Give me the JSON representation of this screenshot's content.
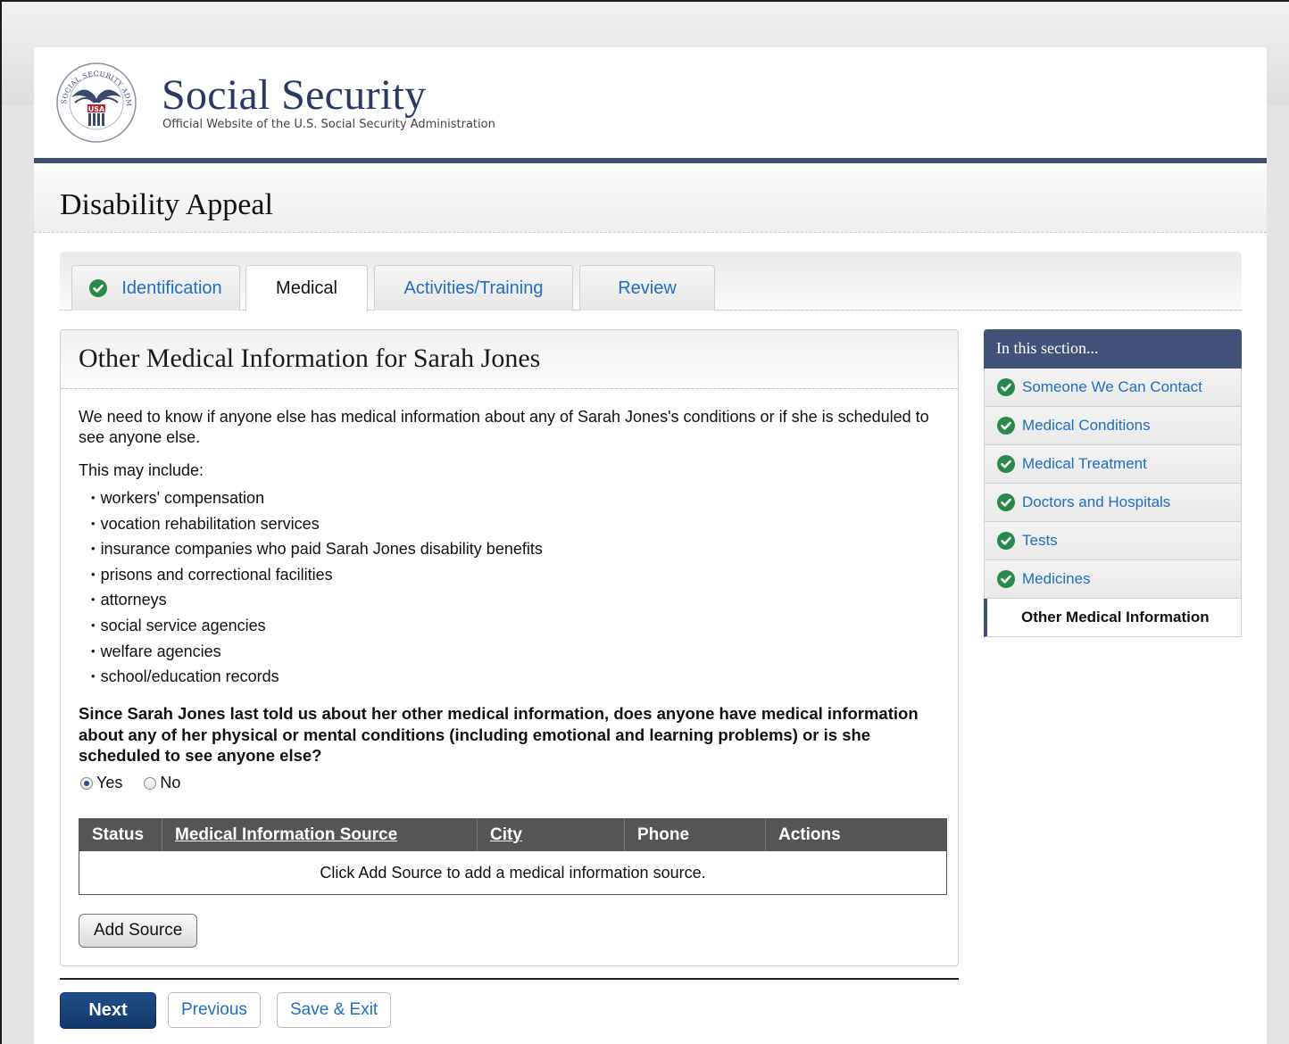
{
  "header": {
    "seal_text": "SOCIAL SECURITY ADMINISTRATION",
    "seal_usa": "USA",
    "brand_title": "Social Security",
    "brand_subtitle": "Official Website of the U.S. Social Security Administration"
  },
  "app_title": "Disability Appeal",
  "tabs": [
    {
      "label": "Identification",
      "completed": true,
      "active": false
    },
    {
      "label": "Medical",
      "completed": false,
      "active": true
    },
    {
      "label": "Activities/Training",
      "completed": false,
      "active": false
    },
    {
      "label": "Review",
      "completed": false,
      "active": false
    }
  ],
  "main": {
    "title": "Other Medical Information for Sarah Jones",
    "intro": "We need to know if anyone else has medical information about any of Sarah Jones's conditions or if she is scheduled to see anyone else.",
    "may_include_label": "This may include:",
    "may_include_items": [
      "workers' compensation",
      "vocation rehabilitation services",
      "insurance companies who paid Sarah Jones disability benefits",
      "prisons and correctional facilities",
      "attorneys",
      "social service agencies",
      "welfare agencies",
      "school/education records"
    ],
    "question": "Since Sarah Jones last told us about her other medical information, does anyone have medical information about any of her physical or mental conditions (including emotional and learning problems) or is she scheduled to see anyone else?",
    "answer_options": [
      {
        "label": "Yes",
        "selected": true
      },
      {
        "label": "No",
        "selected": false
      }
    ],
    "table": {
      "columns": [
        {
          "label": "Status",
          "sortable": false
        },
        {
          "label": "Medical Information Source",
          "sortable": true
        },
        {
          "label": "City",
          "sortable": true
        },
        {
          "label": "Phone",
          "sortable": false
        },
        {
          "label": "Actions",
          "sortable": false
        }
      ],
      "empty_message": "Click Add Source to add a medical information source."
    },
    "add_source_label": "Add Source"
  },
  "footer_buttons": {
    "next": "Next",
    "previous": "Previous",
    "save_exit": "Save & Exit"
  },
  "sidebar": {
    "heading": "In this section...",
    "items": [
      {
        "label": "Someone We Can Contact",
        "completed": true
      },
      {
        "label": "Medical Conditions",
        "completed": true
      },
      {
        "label": "Medical Treatment",
        "completed": true
      },
      {
        "label": "Doctors and Hospitals",
        "completed": true
      },
      {
        "label": "Tests",
        "completed": true
      },
      {
        "label": "Medicines",
        "completed": true
      },
      {
        "label": "Other Medical Information",
        "completed": false,
        "current": true
      }
    ]
  },
  "colors": {
    "brand_navy": "#3f4f73",
    "link_blue": "#1f6ec2",
    "check_green": "#27894a",
    "table_header": "#555555",
    "next_button": "#1f4f8c"
  },
  "icons": {
    "completed": "check-circle-icon",
    "logo": "ssa-seal-icon"
  }
}
